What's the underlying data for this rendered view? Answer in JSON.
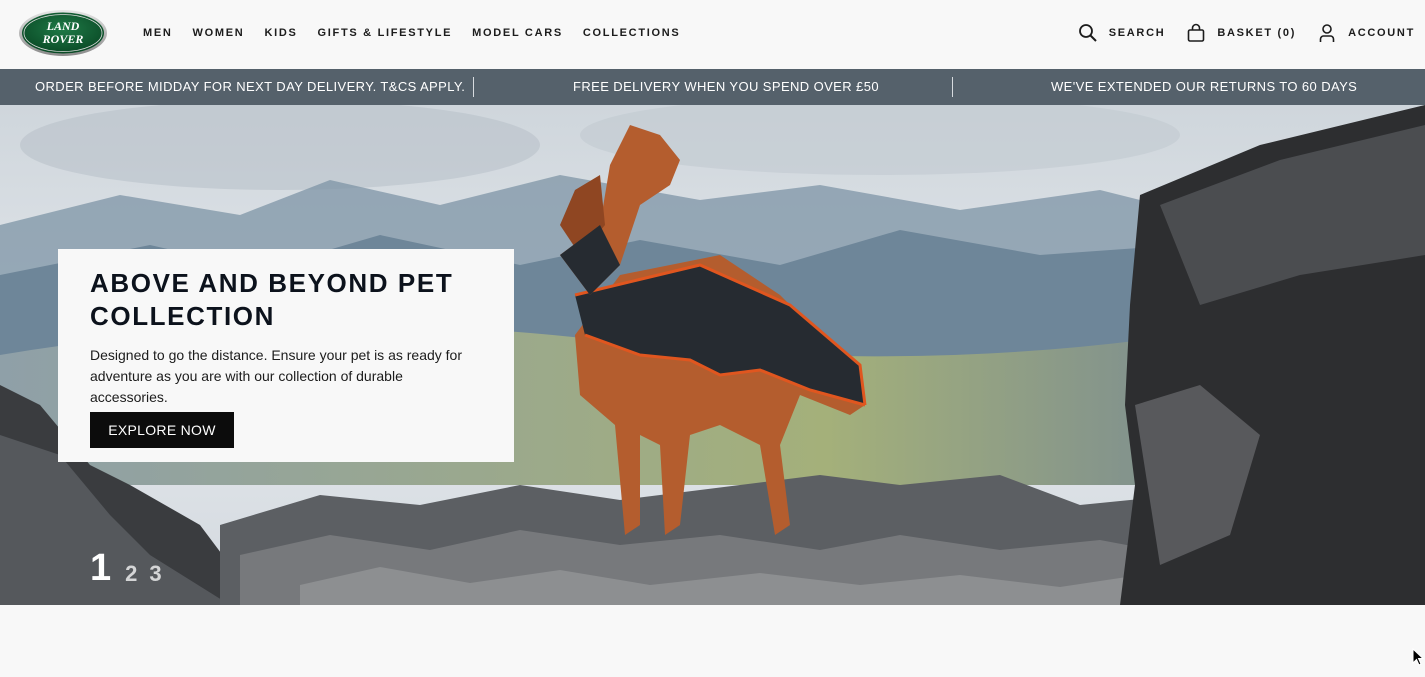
{
  "brand": {
    "logo_text_line1": "LAND",
    "logo_text_line2": "ROVER"
  },
  "nav": [
    {
      "label": "MEN"
    },
    {
      "label": "WOMEN"
    },
    {
      "label": "KIDS"
    },
    {
      "label": "GIFTS & LIFESTYLE"
    },
    {
      "label": "MODEL CARS"
    },
    {
      "label": "COLLECTIONS"
    }
  ],
  "utilities": {
    "search": {
      "label": "SEARCH",
      "icon": "search-icon"
    },
    "basket": {
      "label": "BASKET (0)",
      "icon": "bag-icon"
    },
    "account": {
      "label": "ACCOUNT",
      "icon": "user-icon"
    }
  },
  "promo": [
    "ORDER BEFORE MIDDAY FOR NEXT DAY DELIVERY. T&CS APPLY.",
    "FREE DELIVERY WHEN YOU SPEND OVER £50",
    "WE'VE EXTENDED OUR RETURNS TO 60 DAYS"
  ],
  "hero": {
    "title": "ABOVE AND BEYOND PET COLLECTION",
    "description": "Designed to go the distance. Ensure your pet is as ready for adventure as you are with our collection of durable accessories.",
    "cta": "EXPLORE NOW",
    "pager": [
      "1",
      "2",
      "3"
    ]
  },
  "colors": {
    "promo_bar": "#55616b",
    "logo_green": "#005a2b",
    "button": "#0c0c0c",
    "page_bg": "#f8f8f8"
  }
}
